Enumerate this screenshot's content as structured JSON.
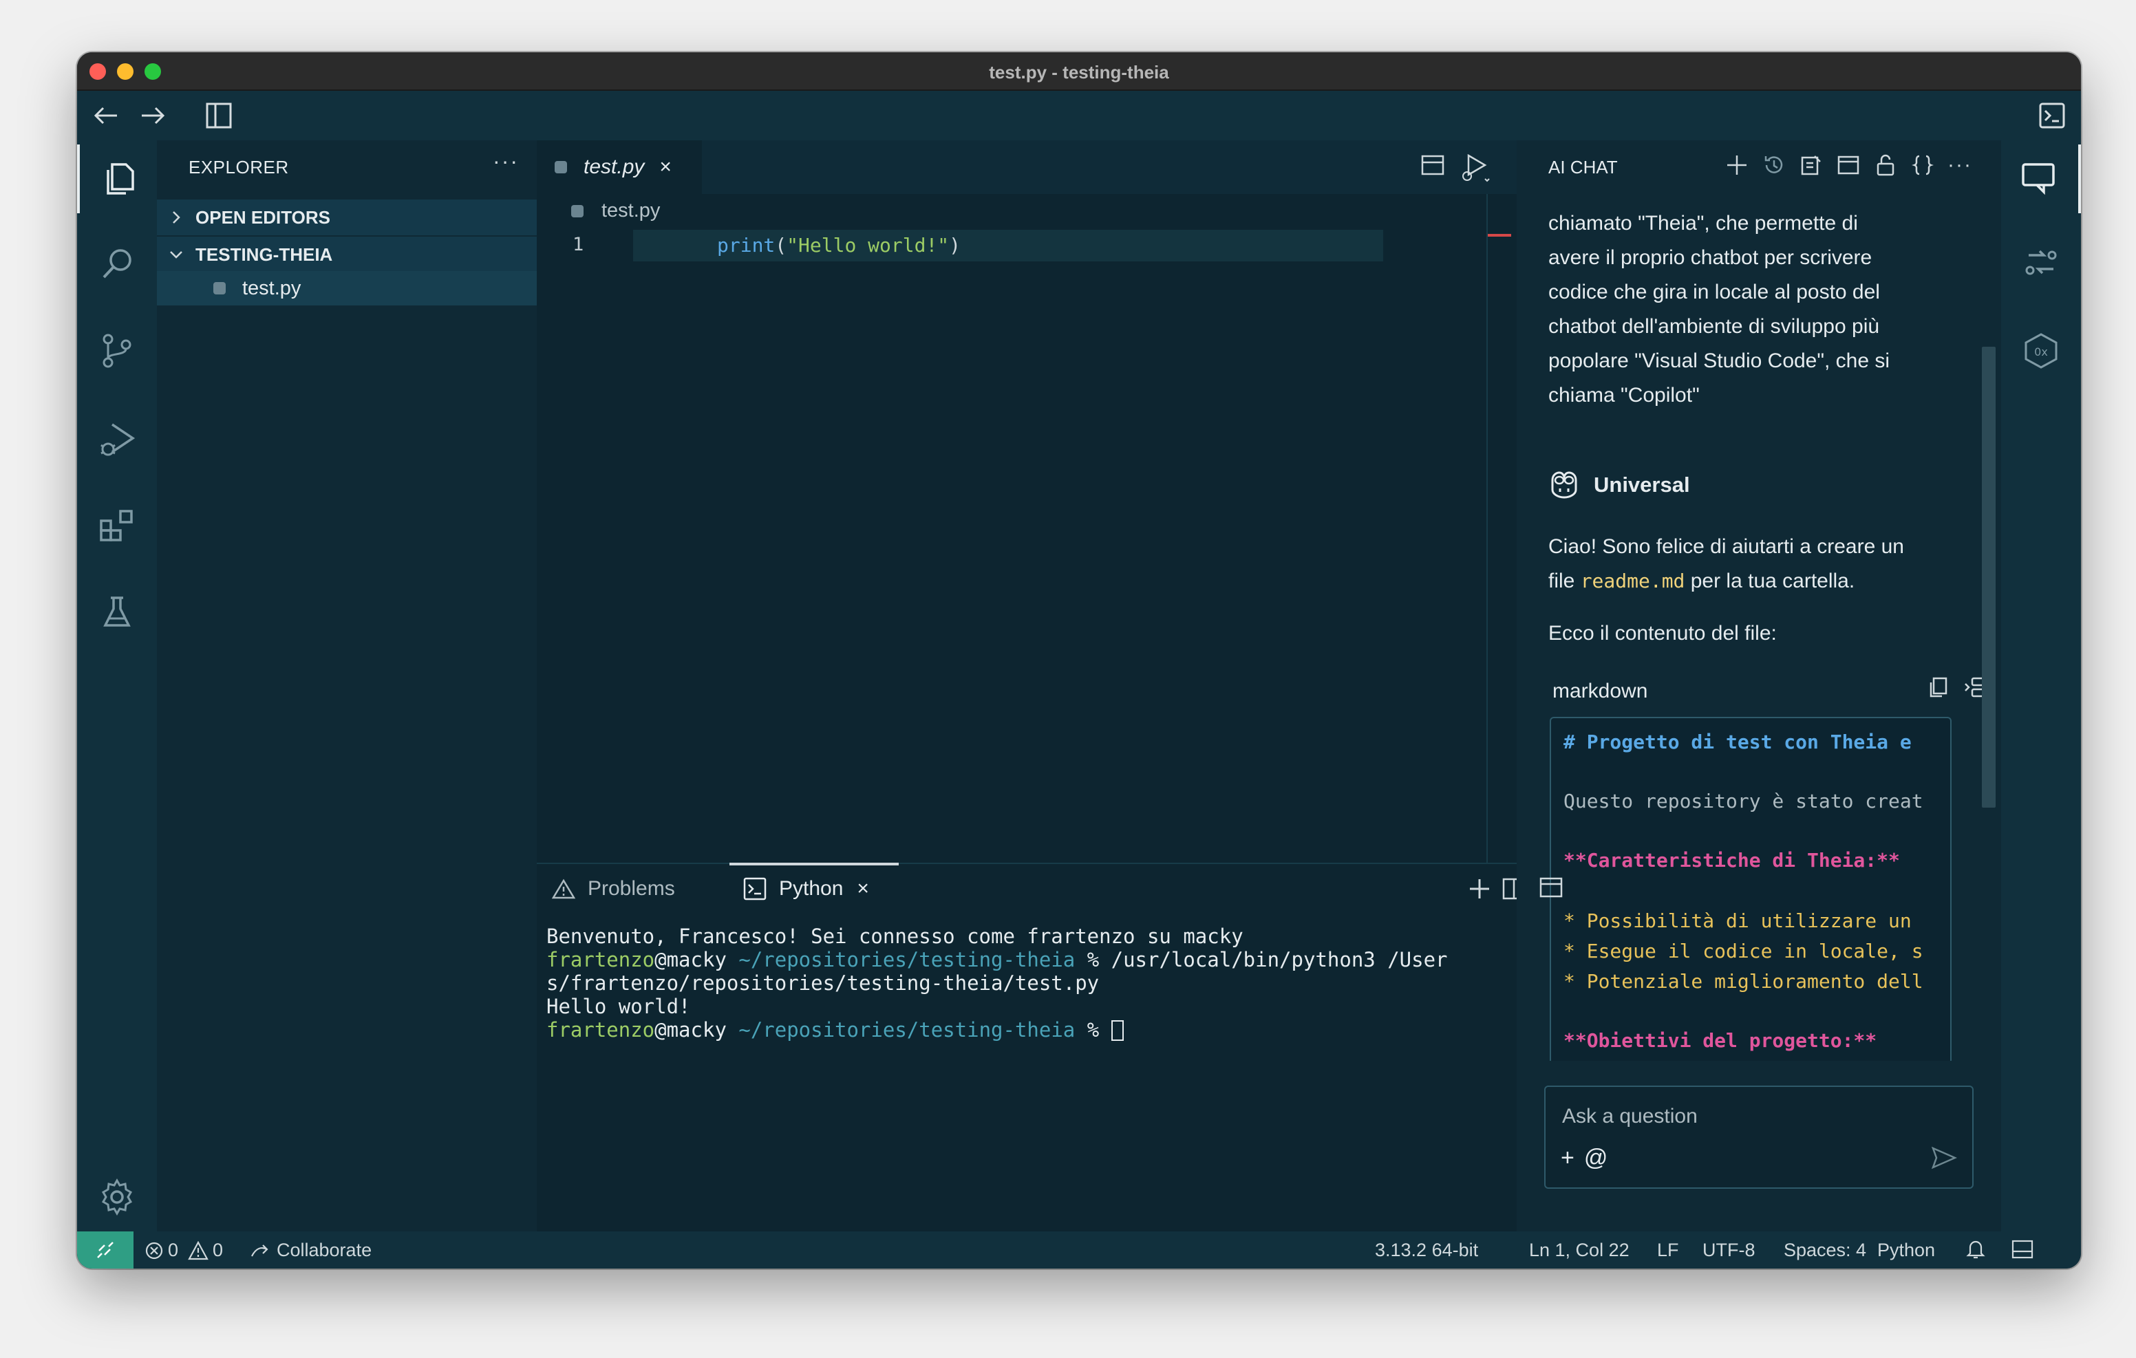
{
  "window": {
    "title": "test.py - testing-theia"
  },
  "explorer": {
    "header": "EXPLORER",
    "more": "···",
    "sections": [
      {
        "label": "OPEN EDITORS",
        "expanded": false
      },
      {
        "label": "TESTING-THEIA",
        "expanded": true
      }
    ],
    "files": [
      {
        "name": "test.py"
      }
    ]
  },
  "editor": {
    "tab": {
      "name": "test.py",
      "close": "×"
    },
    "breadcrumb": "test.py",
    "lines": [
      {
        "number": "1",
        "fn": "print",
        "open": "(",
        "str": "\"Hello world!\"",
        "close": ")"
      }
    ]
  },
  "panel": {
    "tabs": [
      {
        "label": "Problems",
        "icon": "warning-icon"
      },
      {
        "label": "Python",
        "icon": "terminal-icon",
        "close": "×"
      }
    ],
    "terminal": {
      "welcome": "Benvenuto, Francesco! Sei connesso come frartenzo su macky",
      "user": "frartenzo",
      "host": "@macky",
      "path": "~/repositories/testing-theia",
      "cmd_line_rest": " % /usr/local/bin/python3 /User",
      "cmd_line_wrap": "s/frartenzo/repositories/testing-theia/test.py",
      "output": "Hello world!",
      "prompt_suffix": " % "
    }
  },
  "chat": {
    "title": "AI CHAT",
    "intro_lines": [
      "chiamato \"Theia\", che permette di",
      "avere il proprio chatbot per scrivere",
      "codice che gira in locale al posto del",
      "chatbot dell'ambiente di sviluppo più",
      "popolare \"Visual Studio Code\", che si",
      "chiama \"Copilot\""
    ],
    "agent": "Universal",
    "reply_line1": "Ciao! Sono felice di aiutarti a creare un",
    "reply_file_prefix": "file ",
    "reply_file_code": "readme.md",
    "reply_file_suffix": " per la tua cartella.",
    "reply2": "Ecco il contenuto del file:",
    "codeblock_lang": "markdown",
    "codeblock_lines": [
      {
        "kind": "h",
        "text": "# Progetto di test con Theia e "
      },
      {
        "kind": "t",
        "text": "Questo repository è stato creat"
      },
      {
        "kind": "b",
        "text": "**Caratteristiche di Theia:**"
      },
      {
        "kind": "li",
        "text": "* Possibilità di utilizzare un"
      },
      {
        "kind": "li",
        "text": "* Esegue il codice in locale, s"
      },
      {
        "kind": "li",
        "text": "* Potenziale miglioramento dell"
      },
      {
        "kind": "b",
        "text": "**Obiettivi del progetto:**"
      }
    ],
    "input_placeholder": "Ask a question",
    "input_add": "+",
    "input_mention": "@"
  },
  "statusbar": {
    "errors": "0",
    "warnings": "0",
    "collaborate": "Collaborate",
    "interpreter": "3.13.2 64-bit",
    "position": "Ln 1, Col 22",
    "eol": "LF",
    "encoding": "UTF-8",
    "spaces": "Spaces: 4",
    "language": "Python"
  },
  "colors": {
    "background": "#0e2a36",
    "accent_remote": "#2f9e84",
    "string": "#9ccc65",
    "function": "#5aa9e6",
    "md_bold": "#e0569c",
    "md_list": "#e8c25a"
  }
}
